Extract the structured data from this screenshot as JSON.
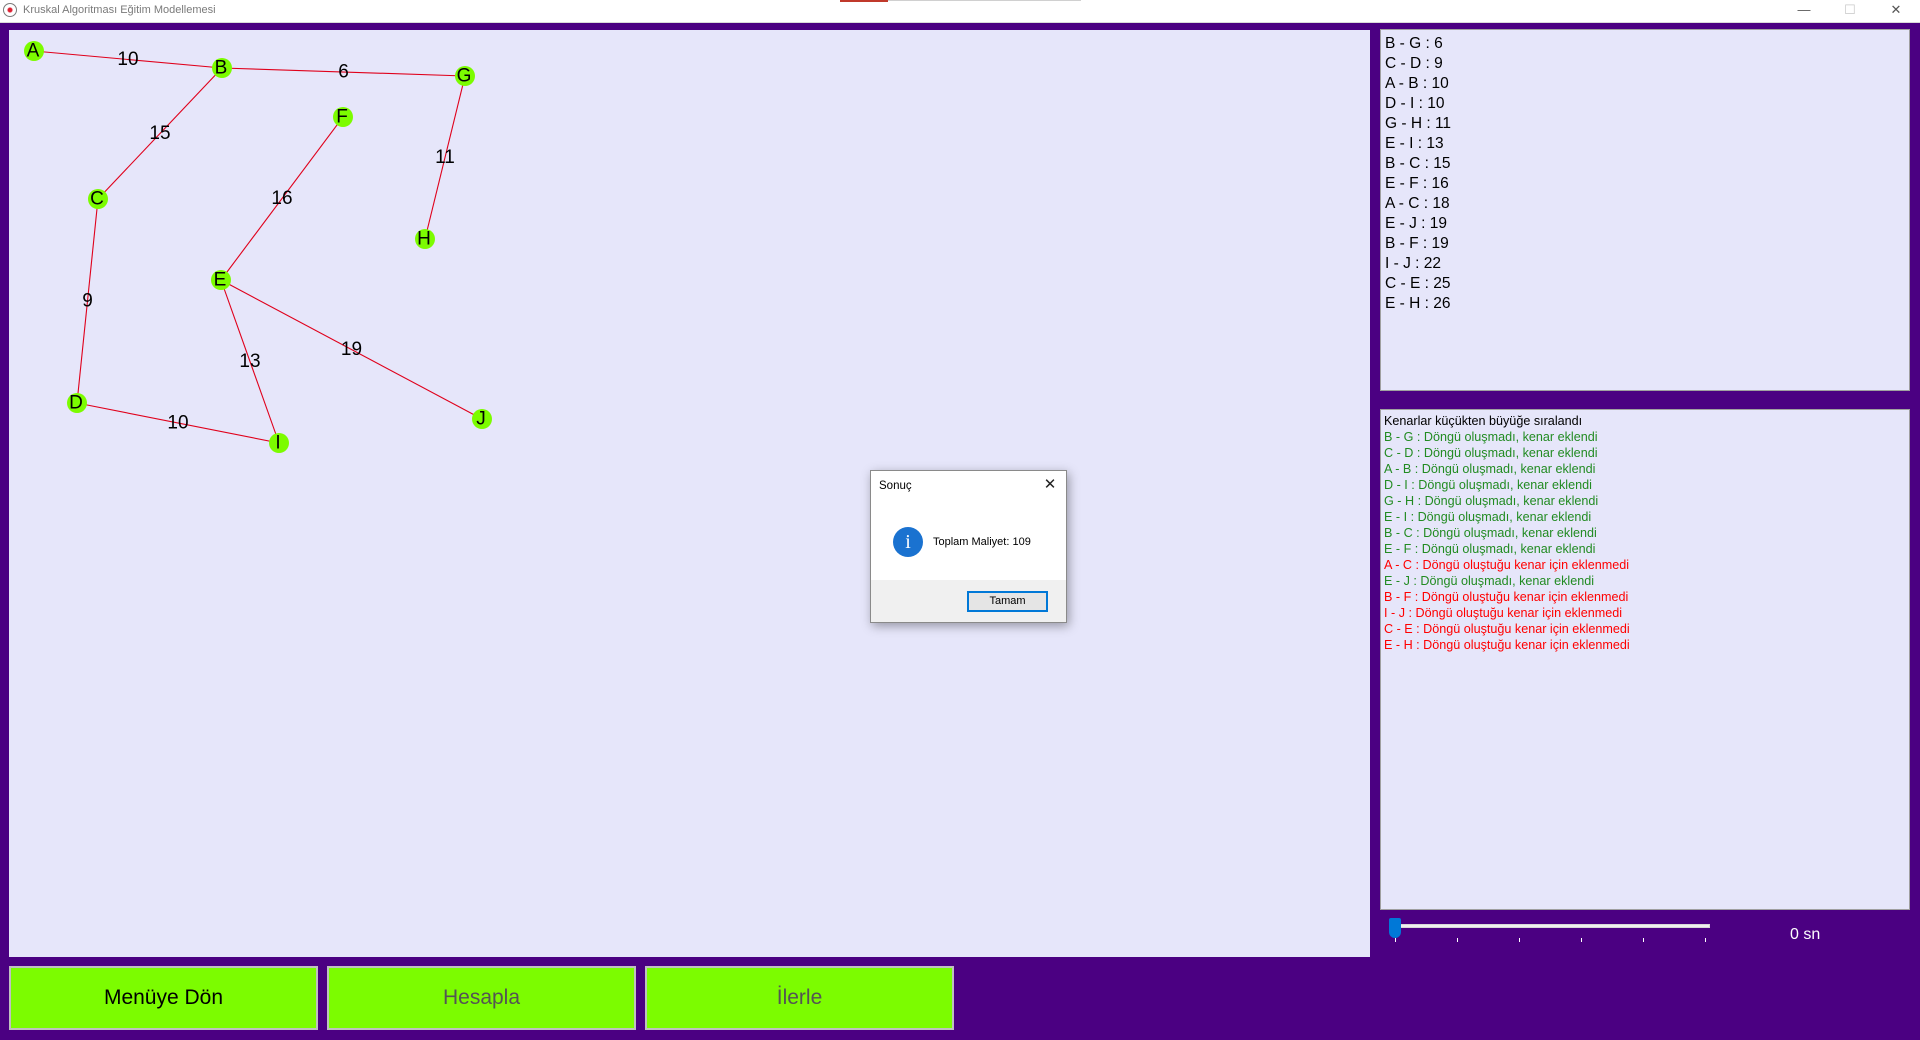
{
  "window": {
    "title": "Kruskal Algoritması Eğitim Modellemesi",
    "min_glyph": "—",
    "max_glyph": "☐",
    "close_glyph": "✕"
  },
  "graph": {
    "nodes": [
      {
        "id": "A"
      },
      {
        "id": "B"
      },
      {
        "id": "G"
      },
      {
        "id": "F"
      },
      {
        "id": "C"
      },
      {
        "id": "H"
      },
      {
        "id": "E"
      },
      {
        "id": "D"
      },
      {
        "id": "I"
      },
      {
        "id": "J"
      }
    ],
    "edges": [
      {
        "from": "A",
        "to": "B",
        "weight": "10"
      },
      {
        "from": "B",
        "to": "G",
        "weight": "6"
      },
      {
        "from": "B",
        "to": "C",
        "weight": "15"
      },
      {
        "from": "G",
        "to": "H",
        "weight": "11"
      },
      {
        "from": "F",
        "to": "E",
        "weight": "16"
      },
      {
        "from": "C",
        "to": "D",
        "weight": "9"
      },
      {
        "from": "E",
        "to": "I",
        "weight": "13"
      },
      {
        "from": "E",
        "to": "J",
        "weight": "19"
      },
      {
        "from": "D",
        "to": "I",
        "weight": "10"
      }
    ],
    "edge_color": "#e0001b",
    "node_color": "#7cfc00"
  },
  "sorted_edges": [
    "B - G : 6",
    "C - D : 9",
    "A - B : 10",
    "D - I : 10",
    "G - H : 11",
    "E - I : 13",
    "B - C : 15",
    "E - F : 16",
    "A - C : 18",
    "E - J : 19",
    "B - F : 19",
    "I - J : 22",
    "C - E : 25",
    "E - H : 26"
  ],
  "log": {
    "header": "Kenarlar küçükten büyüğe sıralandı",
    "entries": [
      {
        "text": "B - G : Döngü oluşmadı, kenar eklendi",
        "status": "ok"
      },
      {
        "text": "C - D : Döngü oluşmadı, kenar eklendi",
        "status": "ok"
      },
      {
        "text": "A - B : Döngü oluşmadı, kenar eklendi",
        "status": "ok"
      },
      {
        "text": "D - I : Döngü oluşmadı, kenar eklendi",
        "status": "ok"
      },
      {
        "text": "G - H : Döngü oluşmadı, kenar eklendi",
        "status": "ok"
      },
      {
        "text": "E - I : Döngü oluşmadı, kenar eklendi",
        "status": "ok"
      },
      {
        "text": "B - C : Döngü oluşmadı, kenar eklendi",
        "status": "ok"
      },
      {
        "text": "E - F : Döngü oluşmadı, kenar eklendi",
        "status": "ok"
      },
      {
        "text": "A - C : Döngü oluştuğu kenar için eklenmedi",
        "status": "bad"
      },
      {
        "text": "E - J : Döngü oluşmadı, kenar eklendi",
        "status": "ok"
      },
      {
        "text": "B - F : Döngü oluştuğu kenar için eklenmedi",
        "status": "bad"
      },
      {
        "text": "I - J : Döngü oluştuğu kenar için eklenmedi",
        "status": "bad"
      },
      {
        "text": "C - E : Döngü oluştuğu kenar için eklenmedi",
        "status": "bad"
      },
      {
        "text": "E - H : Döngü oluştuğu kenar için eklenmedi",
        "status": "bad"
      }
    ],
    "ok_color": "#228b22",
    "bad_color": "#ff0000"
  },
  "speed": {
    "value": 0,
    "label": "0 sn"
  },
  "buttons": {
    "menu": "Menüye Dön",
    "compute": "Hesapla",
    "next": "İlerle"
  },
  "dialog": {
    "title": "Sonuç",
    "message": "Toplam Maliyet: 109",
    "ok": "Tamam",
    "icon": "info-icon",
    "icon_glyph": "i"
  },
  "colors": {
    "frame": "#4b0082",
    "panel": "#e6e6fa",
    "button": "#7cfc00"
  }
}
